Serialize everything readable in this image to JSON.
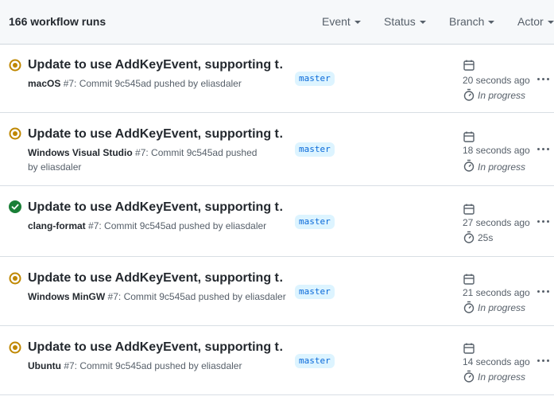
{
  "header": {
    "count_label": "166 workflow runs",
    "filters": [
      {
        "label": "Event"
      },
      {
        "label": "Status"
      },
      {
        "label": "Branch"
      },
      {
        "label": "Actor"
      }
    ]
  },
  "colors": {
    "in_progress": "#bf8700",
    "success": "#1a7f37",
    "branch_bg": "#ddf4ff",
    "branch_fg": "#0969da",
    "muted": "#57606a"
  },
  "runs": [
    {
      "title": "Update to use AddKeyEvent, supporting t…",
      "workflow": "macOS",
      "run_desc": " #7: Commit 9c545ad pushed by eliasdaler",
      "branch": "master",
      "status": "in-progress",
      "time_ago": "20 seconds ago",
      "duration": "In progress"
    },
    {
      "title": "Update to use AddKeyEvent, supporting t…",
      "workflow": "Windows Visual Studio",
      "run_desc": " #7: Commit 9c545ad pushed by eliasdaler",
      "branch": "master",
      "status": "in-progress",
      "time_ago": "18 seconds ago",
      "duration": "In progress"
    },
    {
      "title": "Update to use AddKeyEvent, supporting t…",
      "workflow": "clang-format",
      "run_desc": " #7: Commit 9c545ad pushed by eliasdaler",
      "branch": "master",
      "status": "success",
      "time_ago": "27 seconds ago",
      "duration": "25s"
    },
    {
      "title": "Update to use AddKeyEvent, supporting t…",
      "workflow": "Windows MinGW",
      "run_desc": " #7: Commit 9c545ad pushed by eliasdaler",
      "branch": "master",
      "status": "in-progress",
      "time_ago": "21 seconds ago",
      "duration": "In progress"
    },
    {
      "title": "Update to use AddKeyEvent, supporting t…",
      "workflow": "Ubuntu",
      "run_desc": " #7: Commit 9c545ad pushed by eliasdaler",
      "branch": "master",
      "status": "in-progress",
      "time_ago": "14 seconds ago",
      "duration": "In progress"
    }
  ]
}
